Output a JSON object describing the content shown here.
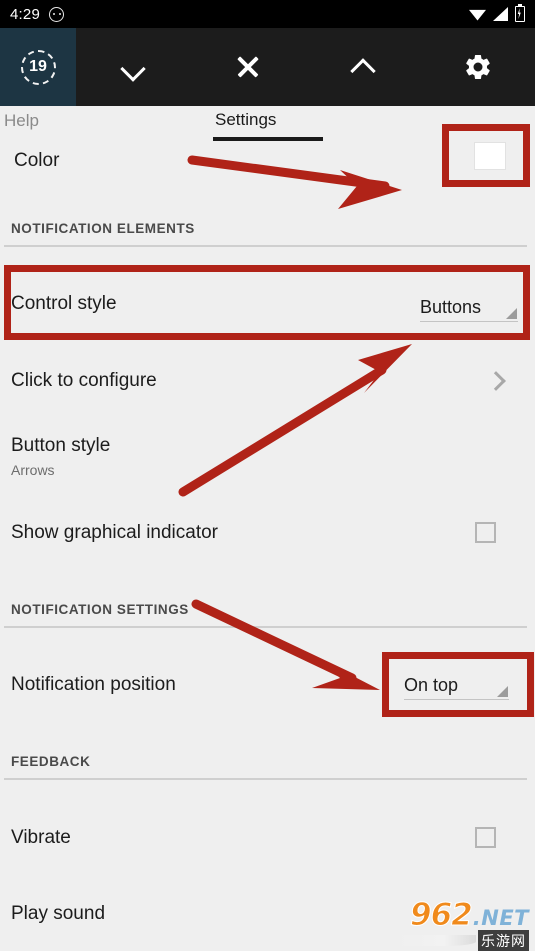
{
  "status_bar": {
    "clock": "4:29",
    "icons": [
      "dnd-icon",
      "wifi-icon",
      "cellular-signal-icon",
      "battery-charging-icon"
    ]
  },
  "toolbar": {
    "badge_count": "19",
    "actions": [
      {
        "name": "chevron-down-icon",
        "label": ""
      },
      {
        "name": "close-icon",
        "label": ""
      },
      {
        "name": "chevron-up-icon",
        "label": ""
      },
      {
        "name": "gear-icon",
        "label": ""
      }
    ]
  },
  "tabs": {
    "inactive": "Help",
    "active": "Settings"
  },
  "rows": {
    "color": {
      "title": "Color",
      "swatch_color": "#ffffff"
    },
    "control_style": {
      "title": "Control style",
      "value": "Buttons"
    },
    "click_to_configure": {
      "title": "Click to configure"
    },
    "button_style": {
      "title": "Button style",
      "subtitle": "Arrows"
    },
    "show_graphical_indicator": {
      "title": "Show graphical indicator",
      "checked": "false"
    },
    "notification_position": {
      "title": "Notification position",
      "value": "On top"
    },
    "vibrate": {
      "title": "Vibrate",
      "checked": "false"
    },
    "play_sound": {
      "title": "Play sound"
    }
  },
  "sections": {
    "notification_elements": "NOTIFICATION ELEMENTS",
    "notification_settings": "NOTIFICATION SETTINGS",
    "feedback": "FEEDBACK"
  },
  "annotations": {
    "color_highlight": "highlight-color-swatch",
    "control_style_highlight": "highlight-control-style-row",
    "notification_position_highlight": "highlight-notification-position",
    "arrow_color": "#b02318",
    "arrow_count": "3"
  },
  "watermark": {
    "brand": "962",
    "tld": ".NET",
    "chinese": "乐游网"
  },
  "theme": {
    "background": "#efefef",
    "toolbar_background": "#1c1c1c",
    "badge_background": "#1d3543",
    "status_background": "#000000",
    "annotation_red": "#b02318",
    "divider": "#cfcfcf",
    "primary_text": "#1c1c1c",
    "secondary_text": "#6d6d6d"
  }
}
